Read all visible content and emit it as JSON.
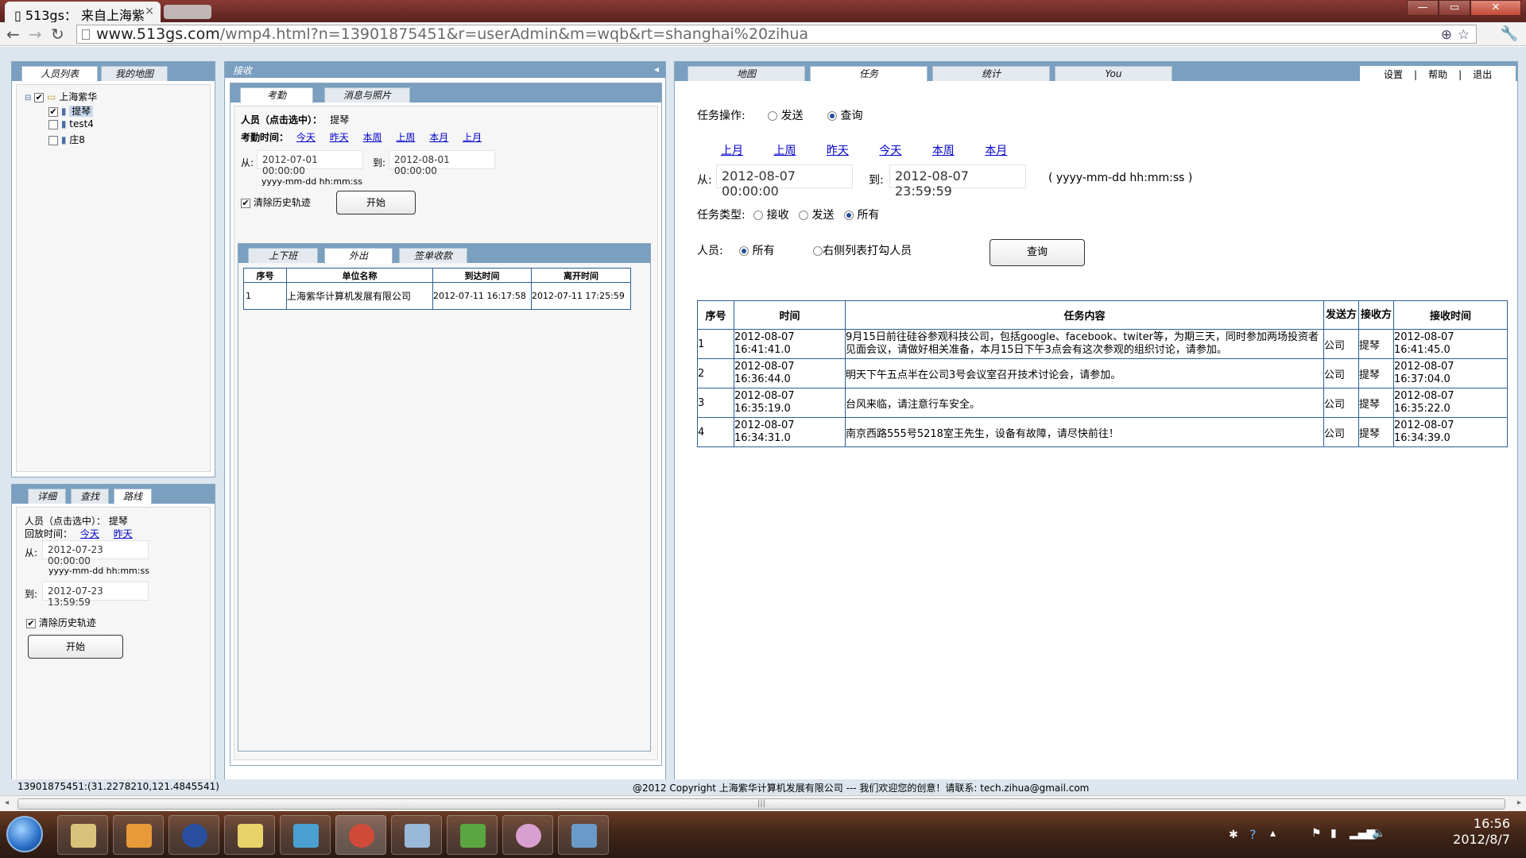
{
  "browser": {
    "tab_title": "513gs： 来自上海紫",
    "url_host": "www.513gs.com",
    "url_path": "/wmp4.html?n=13901875451&r=userAdmin&m=wqb&rt=shanghai%20zihua",
    "win_buttons": [
      "—",
      "▭",
      "✕"
    ]
  },
  "left_top": {
    "tabs": [
      "人员列表",
      "我的地图"
    ],
    "tree": {
      "root": "上海紫华",
      "children": [
        "提琴",
        "test4",
        "庄8"
      ]
    }
  },
  "left_bottom": {
    "tabs": [
      "详细",
      "查找",
      "路线"
    ],
    "person_label": "人员（点击选中）：",
    "person_value": "提琴",
    "replay_label": "回放时间：",
    "links": [
      "今天",
      "昨天"
    ],
    "from_label": "从:",
    "from_value": "2012-07-23 00:00:00",
    "format_hint": "yyyy-mm-dd hh:mm:ss",
    "to_label": "到:",
    "to_value": "2012-07-23 13:59:59",
    "clear_label": "清除历史轨迹",
    "start_label": "开始"
  },
  "middle": {
    "header": "接收",
    "collapse_glyph": "◂",
    "tabs": [
      "考勤",
      "消息与照片"
    ],
    "person_label": "人员（点击选中）：",
    "person_value": "提琴",
    "time_label": "考勤时间：",
    "links": [
      "今天",
      "昨天",
      "本周",
      "上周",
      "本月",
      "上月"
    ],
    "from_label": "从:",
    "from_value": "2012-07-01 00:00:00",
    "to_label": "到:",
    "to_value": "2012-08-01 00:00:00",
    "format_hint": "yyyy-mm-dd hh:mm:ss",
    "clear_label": "清除历史轨迹",
    "start_label": "开始",
    "subtabs": [
      "上下班",
      "外出",
      "签单收款"
    ],
    "table": {
      "headers": [
        "序号",
        "单位名称",
        "到达时间",
        "离开时间"
      ],
      "rows": [
        [
          "1",
          "上海紫华计算机发展有限公司",
          "2012-07-11 16:17:58",
          "2012-07-11 17:25:59"
        ]
      ]
    }
  },
  "right": {
    "tabs": [
      "地图",
      "任务",
      "统计",
      "You"
    ],
    "menu": [
      "设置",
      "帮助",
      "退出"
    ],
    "op_label": "任务操作:",
    "op_options": [
      "发送",
      "查询"
    ],
    "links": [
      "上月",
      "上周",
      "昨天",
      "今天",
      "本周",
      "本月"
    ],
    "from_label": "从:",
    "from_value": "2012-08-07 00:00:00",
    "to_label": "到:",
    "to_value": "2012-08-07 23:59:59",
    "format_hint": "( yyyy-mm-dd hh:mm:ss )",
    "type_label": "任务类型:",
    "type_options": [
      "接收",
      "发送",
      "所有"
    ],
    "person_label": "人员:",
    "person_options": [
      "所有",
      "右侧列表打勾人员"
    ],
    "query_label": "查询",
    "table": {
      "headers": [
        "序号",
        "时间",
        "任务内容",
        "发送方",
        "接收方",
        "接收时间"
      ],
      "rows": [
        [
          "1",
          "2012-08-07 16:41:41.0",
          "9月15日前往硅谷参观科技公司，包括google、facebook、twiter等，为期三天，同时参加两场投资者见面会议，请做好相关准备，本月15日下午3点会有这次参观的组织讨论，请参加。",
          "公司",
          "提琴",
          "2012-08-07 16:41:45.0"
        ],
        [
          "2",
          "2012-08-07 16:36:44.0",
          "明天下午五点半在公司3号会议室召开技术讨论会，请参加。",
          "公司",
          "提琴",
          "2012-08-07 16:37:04.0"
        ],
        [
          "3",
          "2012-08-07 16:35:19.0",
          "台风来临，请注意行车安全。",
          "公司",
          "提琴",
          "2012-08-07 16:35:22.0"
        ],
        [
          "4",
          "2012-08-07 16:34:31.0",
          "南京西路555号5218室王先生，设备有故障，请尽快前往！",
          "公司",
          "提琴",
          "2012-08-07 16:34:39.0"
        ]
      ]
    }
  },
  "status": {
    "coords": "13901875451:(31.2278210,121.4845541)",
    "copyright": "@2012 Copyright   上海紫华计算机发展有限公司   --- 我们欢迎您的创意！请联系: tech.zihua@gmail.com"
  },
  "taskbar": {
    "time": "16:56",
    "date": "2012/8/7",
    "icon_colors": [
      "#d9c37a",
      "#e89a3a",
      "#2a4f9e",
      "#e8d36a",
      "#4aa0d0",
      "#d04a3a",
      "#9ab8d8",
      "#5aa640",
      "#d8a0d0",
      "#6a9ac8"
    ]
  }
}
